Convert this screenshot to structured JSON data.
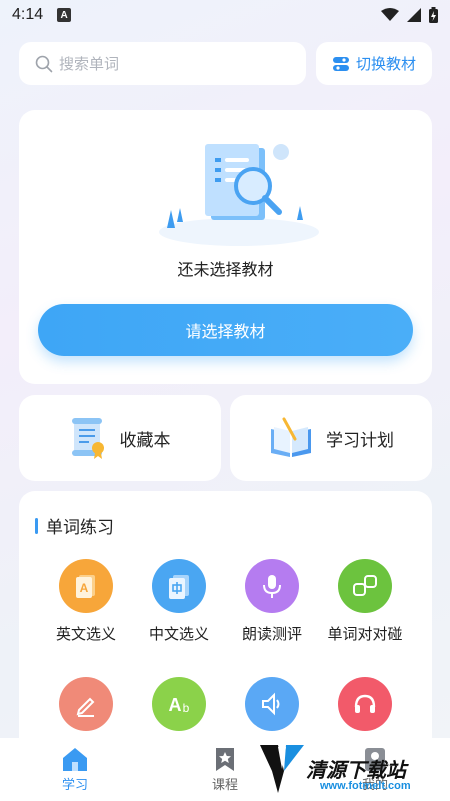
{
  "status_bar": {
    "time": "4:14",
    "badge": "A"
  },
  "search": {
    "placeholder": "搜索单词"
  },
  "switch_textbook": {
    "label": "切换教材"
  },
  "hero": {
    "empty_text": "还未选择教材",
    "button_label": "请选择教材"
  },
  "shortcuts": [
    {
      "label": "收藏本",
      "icon": "scroll-certificate-icon"
    },
    {
      "label": "学习计划",
      "icon": "open-book-icon"
    }
  ],
  "practice": {
    "title": "单词练习",
    "items": [
      {
        "label": "英文选义",
        "icon": "english-card-icon",
        "color": "#f7a63a"
      },
      {
        "label": "中文选义",
        "icon": "chinese-card-icon",
        "color": "#4aa6f2"
      },
      {
        "label": "朗读测评",
        "icon": "microphone-icon",
        "color": "#b57cf0"
      },
      {
        "label": "单词对对碰",
        "icon": "matching-blocks-icon",
        "color": "#6cc33e"
      },
      {
        "label": "",
        "icon": "pencil-icon",
        "color": "#f08a78"
      },
      {
        "label": "",
        "icon": "spelling-ab-icon",
        "color": "#8bd24a"
      },
      {
        "label": "",
        "icon": "speaker-icon",
        "color": "#5aa8f5"
      },
      {
        "label": "",
        "icon": "headphones-icon",
        "color": "#f25a6a"
      }
    ]
  },
  "bottom_nav": [
    {
      "label": "学习",
      "icon": "home-icon",
      "active": true
    },
    {
      "label": "课程",
      "icon": "bookmark-star-icon",
      "active": false
    },
    {
      "label": "我的",
      "icon": "profile-icon",
      "active": false
    }
  ],
  "watermark": {
    "text": "清源下载站",
    "url": "www.fotmelt.com"
  }
}
